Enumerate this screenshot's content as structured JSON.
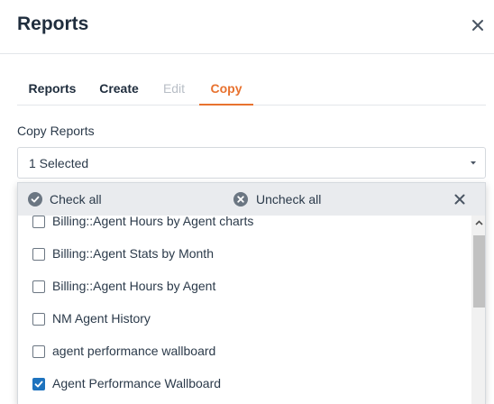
{
  "dialog": {
    "title": "Reports",
    "close_icon": "close-icon"
  },
  "tabs": [
    {
      "label": "Reports",
      "state": "normal"
    },
    {
      "label": "Create",
      "state": "normal"
    },
    {
      "label": "Edit",
      "state": "disabled"
    },
    {
      "label": "Copy",
      "state": "active"
    }
  ],
  "copy_reports": {
    "label": "Copy Reports",
    "selected_text": "1 Selected"
  },
  "dropdown": {
    "check_all_label": "Check all",
    "uncheck_all_label": "Uncheck all",
    "items": [
      {
        "label": "Billing::Agent Hours by Agent charts",
        "checked": false
      },
      {
        "label": "Billing::Agent Stats by Month",
        "checked": false
      },
      {
        "label": "Billing::Agent Hours by Agent",
        "checked": false
      },
      {
        "label": "NM Agent History",
        "checked": false
      },
      {
        "label": "agent performance wallboard",
        "checked": false
      },
      {
        "label": "Agent Performance Wallboard",
        "checked": true
      }
    ]
  },
  "colors": {
    "accent": "#e8722f",
    "checkbox_checked": "#1e73be",
    "toolbar_bg": "#e9ebee"
  }
}
